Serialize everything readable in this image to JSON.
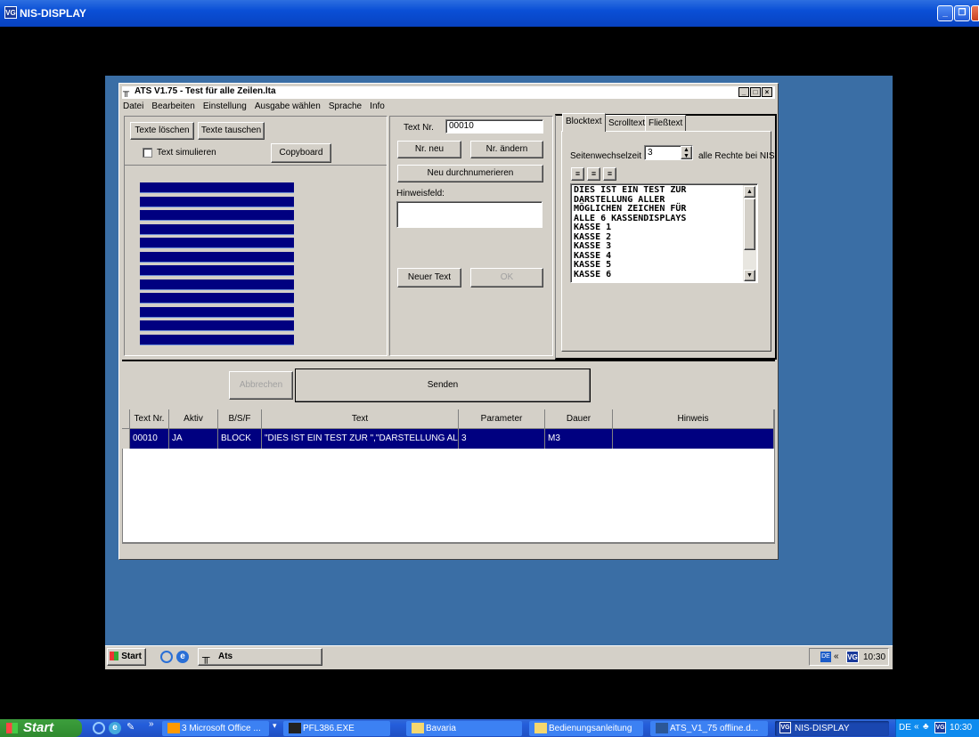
{
  "outer_window": {
    "title": "NIS-DISPLAY",
    "logo": "VG"
  },
  "app_window": {
    "title": "ATS V1.75 - Test für alle Zeilen.lta",
    "menu": [
      "Datei",
      "Bearbeiten",
      "Einstellung",
      "Ausgabe wählen",
      "Sprache",
      "Info"
    ]
  },
  "left_panel": {
    "texte_loeschen": "Texte löschen",
    "texte_tauschen": "Texte tauschen",
    "text_simulieren": "Text simulieren",
    "copyboard": "Copyboard"
  },
  "middle_panel": {
    "text_nr_label": "Text Nr.",
    "text_nr_value": "00010",
    "nr_neu": "Nr. neu",
    "nr_aendern": "Nr. ändern",
    "neu_durchnumerieren": "Neu durchnumerieren",
    "hinweisfeld_label": "Hinweisfeld:",
    "hinweisfeld_value": "",
    "neuer_text": "Neuer Text",
    "ok": "OK"
  },
  "right_panel": {
    "tabs": [
      "Blocktext",
      "Scrolltext",
      "Fließtext"
    ],
    "seitenwechselzeit_label": "Seitenwechselzeit",
    "seitenwechselzeit_value": "3",
    "rechte_label": "alle Rechte bei NIS",
    "text_content": "DIES IST EIN TEST ZUR\nDARSTELLUNG ALLER\nMÖGLICHEN ZEICHEN FÜR\nALLE 6 KASSENDISPLAYS\nKASSE 1\nKASSE 2\nKASSE 3\nKASSE 4\nKASSE 5\nKASSE 6"
  },
  "action_bar": {
    "abbrechen": "Abbrechen",
    "senden": "Senden"
  },
  "table": {
    "headers": [
      "Text Nr.",
      "Aktiv",
      "B/S/F",
      "Text",
      "Parameter",
      "Dauer",
      "Hinweis"
    ],
    "rows": [
      {
        "text_nr": "00010",
        "aktiv": "JA",
        "bsf": "BLOCK",
        "text": "\"DIES IST EIN TEST ZUR \",\"DARSTELLUNG ALLE",
        "parameter": "3",
        "dauer": "M3",
        "hinweis": ""
      }
    ]
  },
  "inner_taskbar": {
    "start": "Start",
    "task": "Ats",
    "tray_lang": "DE",
    "clock": "10:30"
  },
  "outer_taskbar": {
    "start": "Start",
    "items": [
      "3 Microsoft Office ...",
      "PFL386.EXE",
      "Bavaria",
      "Bedienungsanleitung",
      "ATS_V1_75 offline.d...",
      "NIS-DISPLAY"
    ],
    "lang": "DE",
    "clock": "10:30"
  },
  "colors": {
    "display_blue": "#000080",
    "desktop_blue": "#3a6ea5",
    "xp_blue": "#245edb"
  },
  "left_panel_display_lines": 12
}
